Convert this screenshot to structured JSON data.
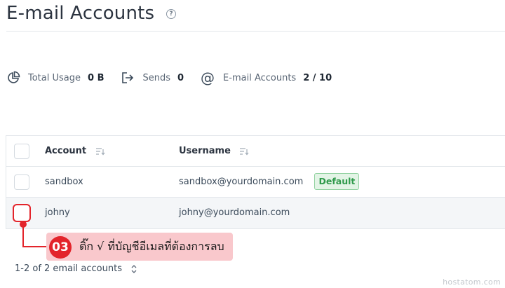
{
  "header": {
    "title": "E-mail Accounts",
    "help_icon_glyph": "?"
  },
  "stats": [
    {
      "icon": "pie-chart-icon",
      "label": "Total Usage",
      "value": "0 B"
    },
    {
      "icon": "send-arrow-icon",
      "label": "Sends",
      "value": "0"
    },
    {
      "icon": "at-sign-icon",
      "label": "E-mail Accounts",
      "value": "2 / 10"
    }
  ],
  "table": {
    "columns": [
      {
        "label": "Account",
        "icon": "sort-icon"
      },
      {
        "label": "Username",
        "icon": "sort-icon"
      }
    ],
    "rows": [
      {
        "account": "sandbox",
        "username": "sandbox@yourdomain.com",
        "badge": "Default",
        "checked": false,
        "selected": false
      },
      {
        "account": "johny",
        "username": "johny@yourdomain.com",
        "badge": "",
        "checked": false,
        "selected": true
      }
    ]
  },
  "callout": {
    "number": "03",
    "text": "ติ๊ก √ ที่บัญชีอีเมลที่ต้องการลบ",
    "color": "#e3242b"
  },
  "pagination": {
    "summary": "1-2 of 2 email accounts",
    "icon": "chevron-updown-icon"
  },
  "watermark": "hostatom.com",
  "colors": {
    "accent": "#e3242b",
    "badge_green": "#2f9a4b",
    "callout_bg": "#f9c8cc"
  }
}
